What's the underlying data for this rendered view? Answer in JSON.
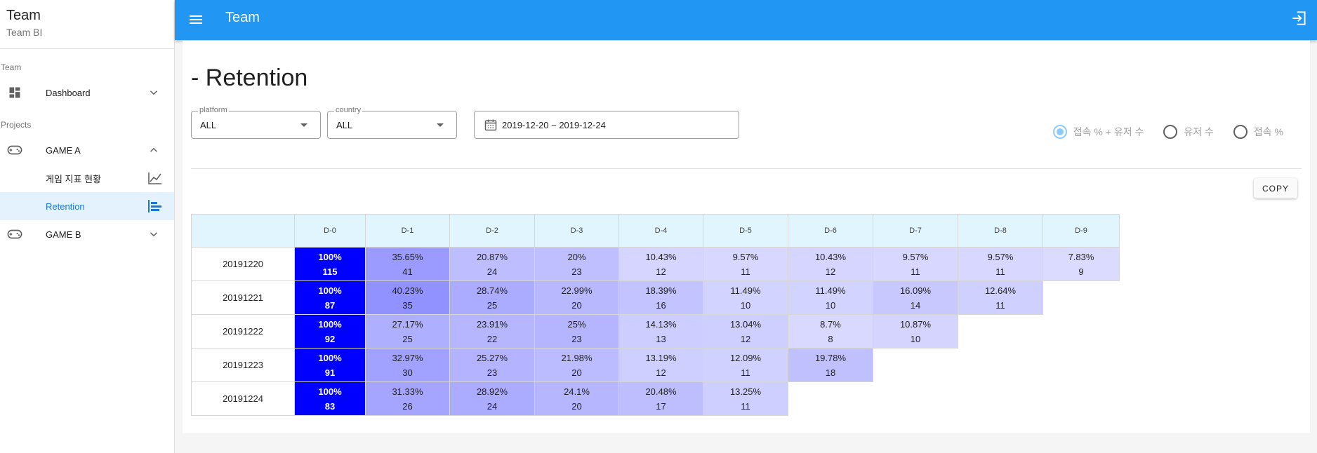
{
  "sidebar": {
    "title": "Team",
    "subtitle": "Team BI",
    "section_team": "Team",
    "dashboard_label": "Dashboard",
    "section_projects": "Projects",
    "game_a_label": "GAME A",
    "sub_item_1_label": "게임 지표 현황",
    "sub_item_2_label": "Retention",
    "game_b_label": "GAME B"
  },
  "appbar": {
    "title": "Team"
  },
  "page": {
    "title": "- Retention"
  },
  "filters": {
    "platform_label": "platform",
    "platform_value": "ALL",
    "country_label": "country",
    "country_value": "ALL",
    "date_range": "2019-12-20 ~ 2019-12-24"
  },
  "view_options": {
    "options": [
      "접속 % + 유저 수",
      "유저 수",
      "접속 %"
    ],
    "selected_index": 0
  },
  "copy_label": "COPY",
  "colors": {
    "appbar": "#2196f3",
    "accent": "#1976d2",
    "d0_cell": "#0000ff",
    "header_bg": "#e1f5fe"
  },
  "table": {
    "columns": [
      "D-0",
      "D-1",
      "D-2",
      "D-3",
      "D-4",
      "D-5",
      "D-6",
      "D-7",
      "D-8",
      "D-9"
    ],
    "rows": [
      {
        "date": "20191220",
        "cells": [
          {
            "pct": "100%",
            "users": "115"
          },
          {
            "pct": "35.65%",
            "users": "41"
          },
          {
            "pct": "20.87%",
            "users": "24"
          },
          {
            "pct": "20%",
            "users": "23"
          },
          {
            "pct": "10.43%",
            "users": "12"
          },
          {
            "pct": "9.57%",
            "users": "11"
          },
          {
            "pct": "10.43%",
            "users": "12"
          },
          {
            "pct": "9.57%",
            "users": "11"
          },
          {
            "pct": "9.57%",
            "users": "11"
          },
          {
            "pct": "7.83%",
            "users": "9"
          }
        ]
      },
      {
        "date": "20191221",
        "cells": [
          {
            "pct": "100%",
            "users": "87"
          },
          {
            "pct": "40.23%",
            "users": "35"
          },
          {
            "pct": "28.74%",
            "users": "25"
          },
          {
            "pct": "22.99%",
            "users": "20"
          },
          {
            "pct": "18.39%",
            "users": "16"
          },
          {
            "pct": "11.49%",
            "users": "10"
          },
          {
            "pct": "11.49%",
            "users": "10"
          },
          {
            "pct": "16.09%",
            "users": "14"
          },
          {
            "pct": "12.64%",
            "users": "11"
          }
        ]
      },
      {
        "date": "20191222",
        "cells": [
          {
            "pct": "100%",
            "users": "92"
          },
          {
            "pct": "27.17%",
            "users": "25"
          },
          {
            "pct": "23.91%",
            "users": "22"
          },
          {
            "pct": "25%",
            "users": "23"
          },
          {
            "pct": "14.13%",
            "users": "13"
          },
          {
            "pct": "13.04%",
            "users": "12"
          },
          {
            "pct": "8.7%",
            "users": "8"
          },
          {
            "pct": "10.87%",
            "users": "10"
          }
        ]
      },
      {
        "date": "20191223",
        "cells": [
          {
            "pct": "100%",
            "users": "91"
          },
          {
            "pct": "32.97%",
            "users": "30"
          },
          {
            "pct": "25.27%",
            "users": "23"
          },
          {
            "pct": "21.98%",
            "users": "20"
          },
          {
            "pct": "13.19%",
            "users": "12"
          },
          {
            "pct": "12.09%",
            "users": "11"
          },
          {
            "pct": "19.78%",
            "users": "18"
          }
        ]
      },
      {
        "date": "20191224",
        "cells": [
          {
            "pct": "100%",
            "users": "83"
          },
          {
            "pct": "31.33%",
            "users": "26"
          },
          {
            "pct": "28.92%",
            "users": "24"
          },
          {
            "pct": "24.1%",
            "users": "20"
          },
          {
            "pct": "20.48%",
            "users": "17"
          },
          {
            "pct": "13.25%",
            "users": "11"
          }
        ]
      }
    ]
  }
}
